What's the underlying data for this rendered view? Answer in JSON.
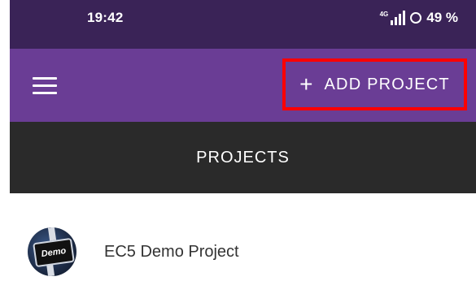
{
  "status_bar": {
    "time": "19:42",
    "network_tag": "4G",
    "battery_percent": "49 %"
  },
  "app_bar": {
    "add_button_label": "ADD PROJECT",
    "add_icon": "+"
  },
  "tabs": {
    "projects_label": "PROJECTS"
  },
  "projects": [
    {
      "name": "EC5 Demo Project",
      "avatar_text": "Demo"
    }
  ],
  "colors": {
    "status_bar_bg": "#3a2357",
    "app_bar_bg": "#6a3d95",
    "tab_bar_bg": "#2a2a2a",
    "highlight_border": "#ff0000"
  }
}
